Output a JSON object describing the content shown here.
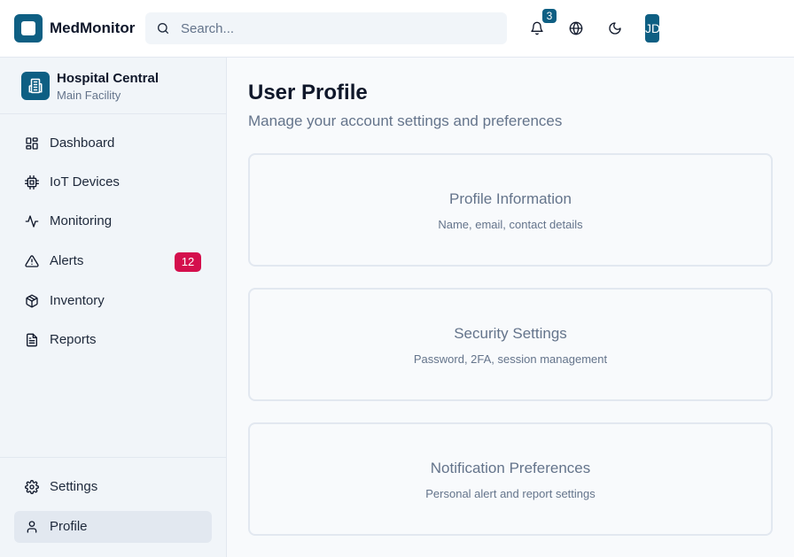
{
  "app": {
    "name": "MedMonitor"
  },
  "search": {
    "placeholder": "Search..."
  },
  "header": {
    "notification_count": "3",
    "avatar_initials": "JD"
  },
  "facility": {
    "name": "Hospital Central",
    "subtitle": "Main Facility"
  },
  "sidebar": {
    "items": [
      {
        "label": "Dashboard",
        "icon": "dashboard-icon"
      },
      {
        "label": "IoT Devices",
        "icon": "chip-icon"
      },
      {
        "label": "Monitoring",
        "icon": "activity-icon"
      },
      {
        "label": "Alerts",
        "icon": "alert-triangle-icon",
        "badge": "12"
      },
      {
        "label": "Inventory",
        "icon": "package-icon"
      },
      {
        "label": "Reports",
        "icon": "file-text-icon"
      }
    ],
    "bottom_items": [
      {
        "label": "Settings",
        "icon": "gear-icon"
      },
      {
        "label": "Profile",
        "icon": "user-icon",
        "active": true
      }
    ]
  },
  "page": {
    "title": "User Profile",
    "subtitle": "Manage your account settings and preferences"
  },
  "cards": [
    {
      "title": "Profile Information",
      "description": "Name, email, contact details"
    },
    {
      "title": "Security Settings",
      "description": "Password, 2FA, session management"
    },
    {
      "title": "Notification Preferences",
      "description": "Personal alert and report settings"
    }
  ],
  "colors": {
    "brand": "#0e5f83",
    "alert_badge": "#d40f4d",
    "sidebar_bg": "#f1f5f9",
    "active_item_bg": "#e2e8f0"
  }
}
